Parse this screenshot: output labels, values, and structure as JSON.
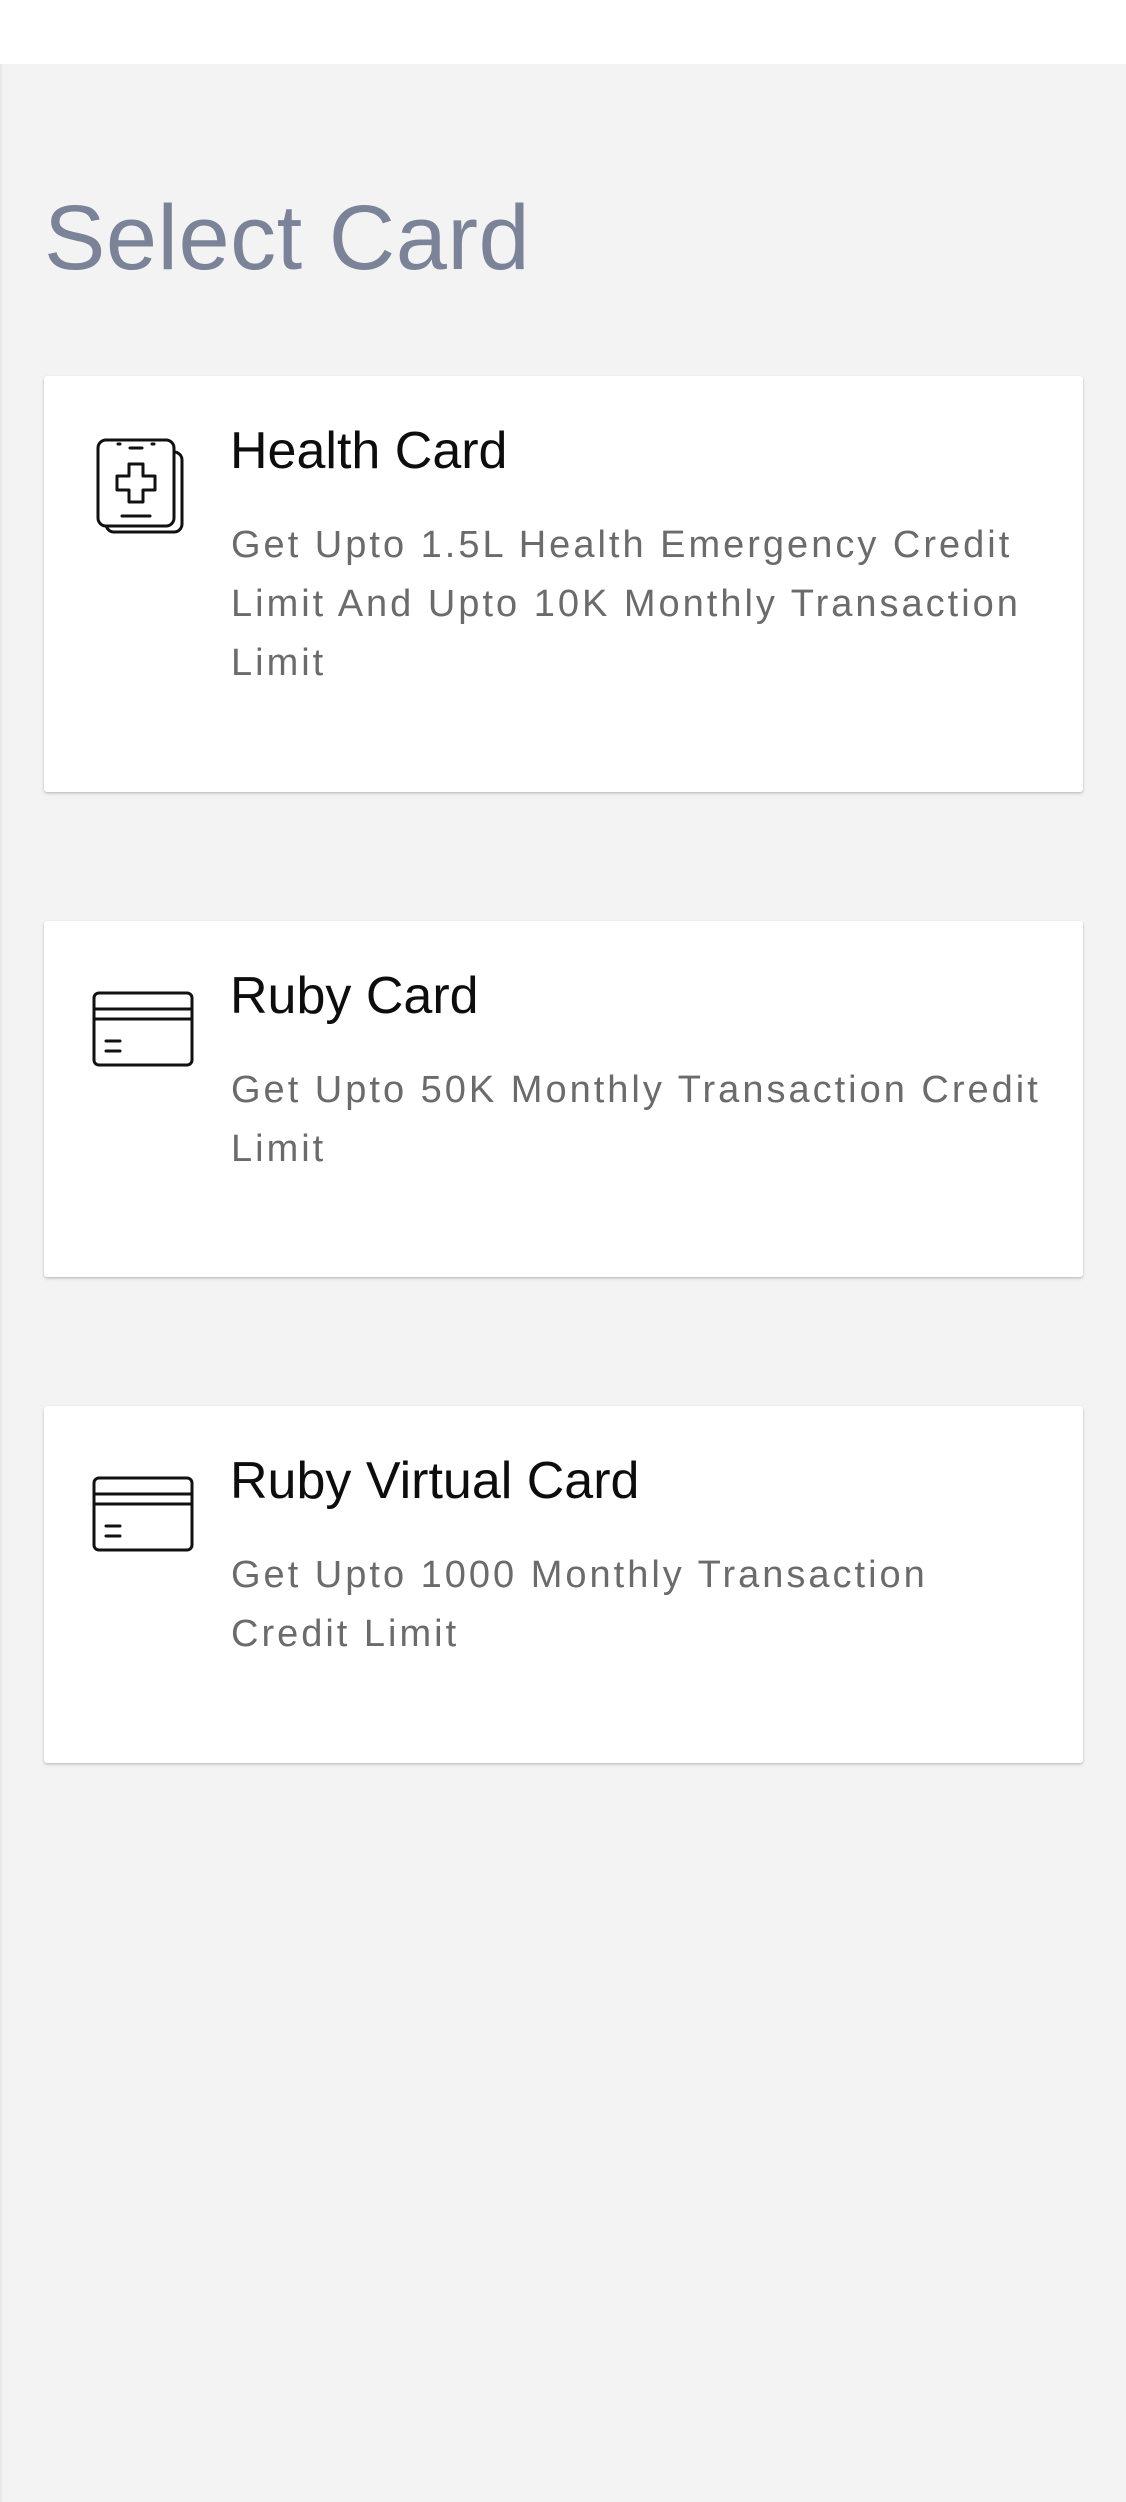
{
  "header": {
    "title": "Select Card"
  },
  "cards": [
    {
      "title": "Health Card",
      "description": "Get Upto 1.5L Health Emergency Credit Limit And Upto 10K Monthly Transaction Limit",
      "icon": "health-card-icon"
    },
    {
      "title": "Ruby Card",
      "description": "Get Upto 50K Monthly Transaction Credit Limit",
      "icon": "credit-card-icon"
    },
    {
      "title": "Ruby Virtual Card",
      "description": "Get Upto 1000 Monthly Transaction Credit Limit",
      "icon": "credit-card-icon"
    }
  ],
  "colors": {
    "background": "#f3f3f3",
    "title": "#7a8398",
    "card_title": "#0d0d0d",
    "card_description": "#6b6b6b"
  }
}
